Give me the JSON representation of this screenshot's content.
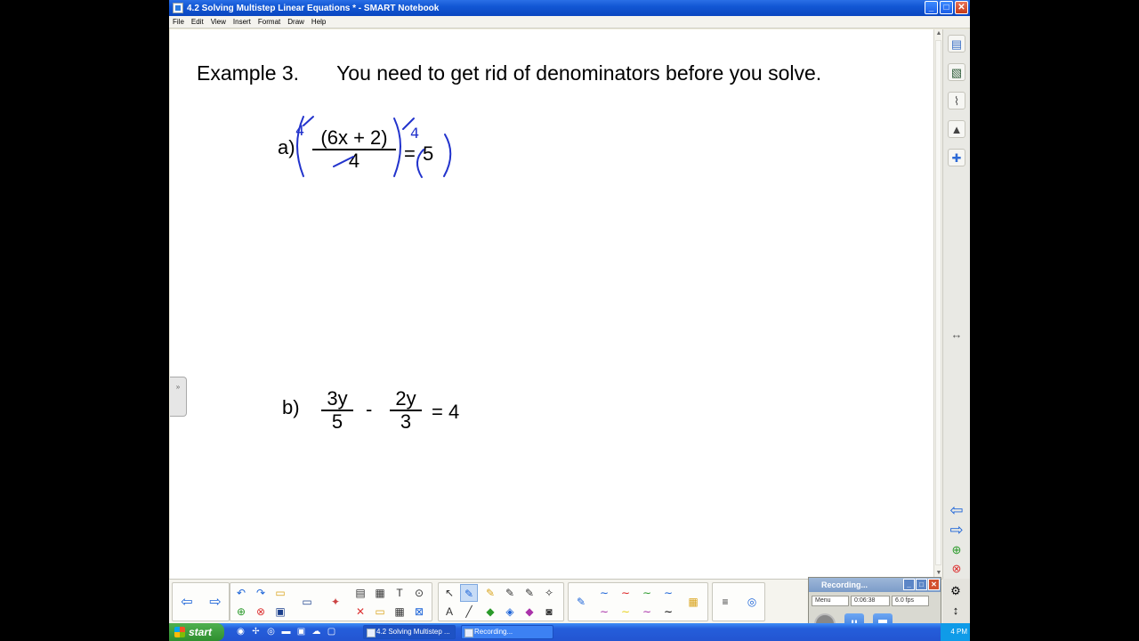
{
  "window": {
    "title": "4.2 Solving Multistep Linear Equations * - SMART Notebook",
    "controls": [
      "_",
      "□",
      "✕"
    ]
  },
  "menu": [
    "File",
    "Edit",
    "View",
    "Insert",
    "Format",
    "Draw",
    "Help"
  ],
  "page": {
    "heading_label": "Example 3.",
    "heading_text": "You need to get rid of denominators before you solve.",
    "example_a": {
      "label": "a)",
      "numerator": "(6x + 2)",
      "denominator": "4",
      "equals": "=",
      "rhs": "5",
      "ink_multiplier_left": "4",
      "ink_multiplier_right": "4"
    },
    "example_b": {
      "label": "b)",
      "term1_num": "3y",
      "term1_den": "5",
      "minus": "-",
      "term2_num": "2y",
      "term2_den": "3",
      "rhs": "= 4"
    },
    "ink_color": "#2233cc"
  },
  "side_tab": {
    "glyph": "»"
  },
  "right_sidebar": {
    "icons": [
      "page-sorter-icon",
      "gallery-icon",
      "attachments-icon",
      "properties-icon",
      "addons-icon"
    ],
    "resize_glyph": "↔",
    "nav": [
      "back-page-icon",
      "forward-page-icon",
      "add-page-icon",
      "delete-page-icon"
    ]
  },
  "recorder": {
    "title": "Recording...",
    "menu_label": "Menu",
    "elapsed": "0:06:38",
    "fps": "6.0 fps",
    "pause_glyph": "II"
  },
  "taskbar": {
    "start_label": "start",
    "tasks": [
      "4.2 Solving Multistep ...",
      "Recording..."
    ],
    "clock": "4 PM"
  }
}
